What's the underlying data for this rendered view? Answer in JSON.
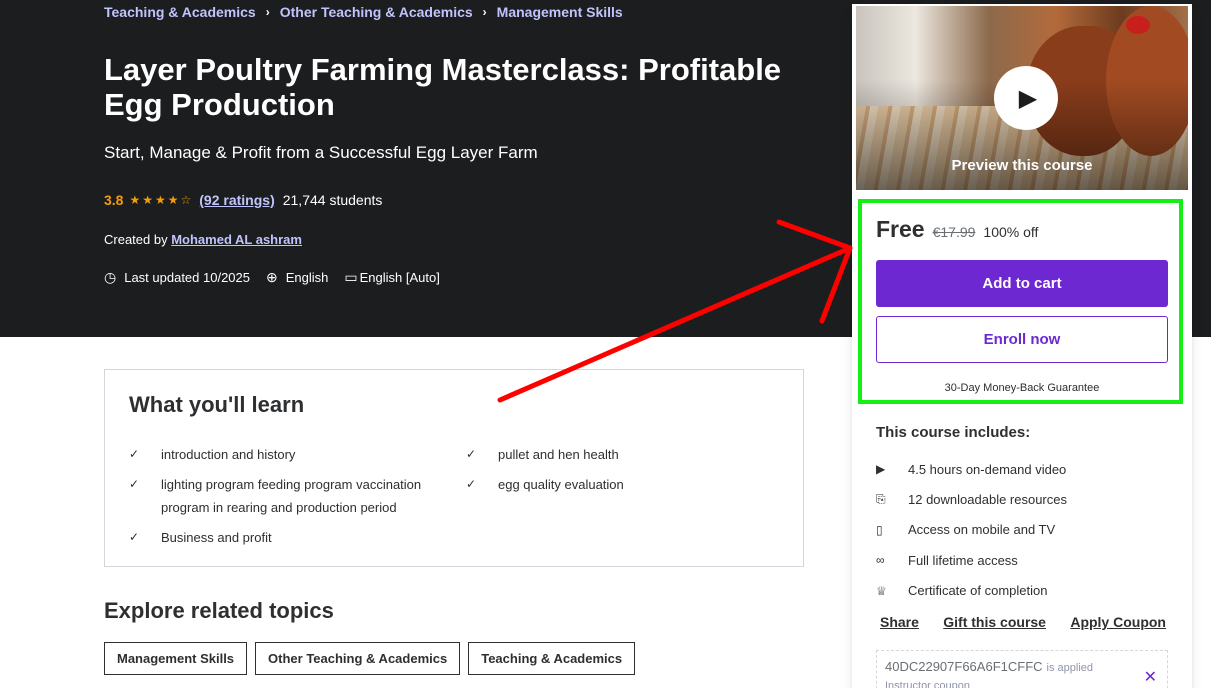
{
  "breadcrumb": [
    "Teaching & Academics",
    "Other Teaching & Academics",
    "Management Skills"
  ],
  "course": {
    "title": "Layer Poultry Farming Masterclass: Profitable Egg Production",
    "subtitle": "Start, Manage & Profit from a Successful Egg Layer Farm",
    "rating": "3.8",
    "stars": "★★★★☆",
    "ratings_count": "(92 ratings)",
    "students": "21,744 students",
    "created_by_label": "Created by",
    "instructor": "Mohamed AL ashram",
    "last_updated": "Last updated 10/2025",
    "language": "English",
    "captions": "English [Auto]"
  },
  "learn": {
    "title": "What you'll learn",
    "items": [
      "introduction and history",
      "pullet and hen health",
      "lighting program feeding program vaccination program in rearing and production period",
      "egg quality evaluation",
      "Business and profit"
    ]
  },
  "explore": {
    "title": "Explore related topics",
    "topics": [
      "Management Skills",
      "Other Teaching & Academics",
      "Teaching & Academics"
    ]
  },
  "sidebar": {
    "preview_label": "Preview this course",
    "price": "Free",
    "old_price": "€17.99",
    "discount": "100% off",
    "add_to_cart": "Add to cart",
    "enroll_now": "Enroll now",
    "guarantee": "30-Day Money-Back Guarantee",
    "includes_title": "This course includes:",
    "includes": [
      {
        "icon": "video-icon",
        "label": "4.5 hours on-demand video"
      },
      {
        "icon": "file-download-icon",
        "label": "12 downloadable resources"
      },
      {
        "icon": "mobile-icon",
        "label": "Access on mobile and TV"
      },
      {
        "icon": "infinity-icon",
        "label": "Full lifetime access"
      },
      {
        "icon": "trophy-icon",
        "label": "Certificate of completion"
      }
    ],
    "links": {
      "share": "Share",
      "gift": "Gift this course",
      "coupon": "Apply Coupon"
    },
    "coupon_code": "40DC22907F66A6F1CFFC",
    "coupon_applied": "is applied",
    "coupon_sub": "Instructor coupon"
  },
  "annotation": {
    "highlight_color": "#14f014",
    "arrow_color": "#ff0000"
  }
}
